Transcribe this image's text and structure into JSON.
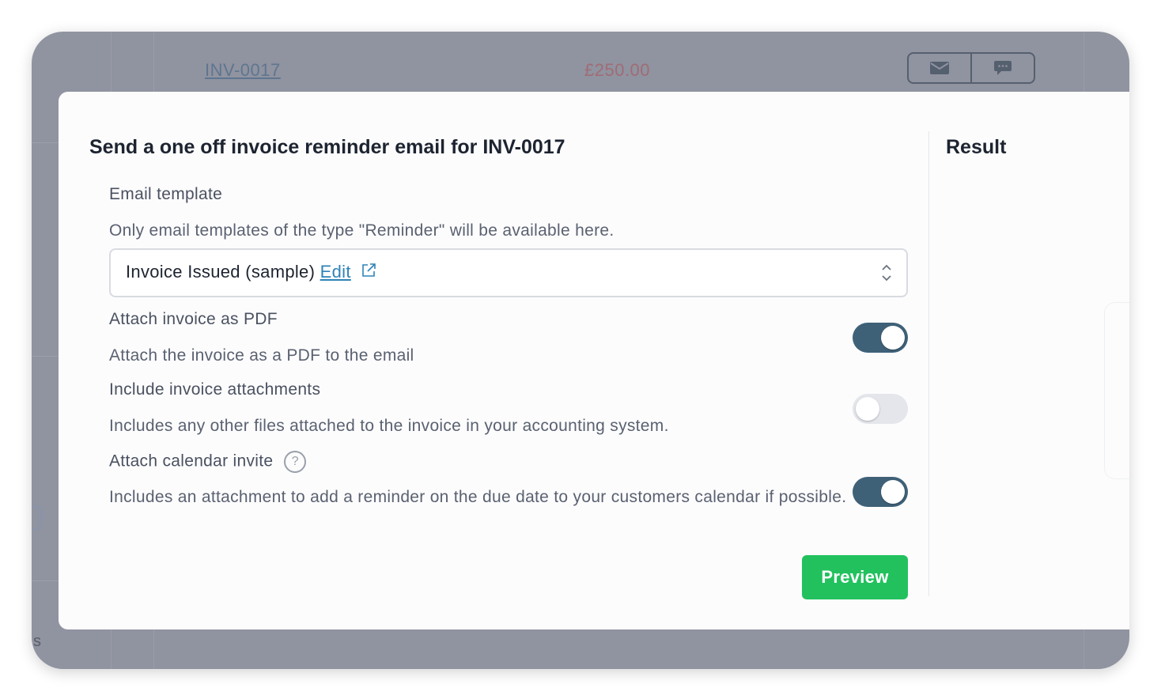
{
  "background": {
    "invoice_number": "INV-0017",
    "amount": "£250.00",
    "action_icons": [
      "envelope-icon",
      "chat-bubble-icon"
    ],
    "partial_text": "s"
  },
  "modal": {
    "title": "Send a one off invoice reminder email for INV-0017",
    "email_template": {
      "label": "Email template",
      "help": "Only email templates of the type \"Reminder\" will be available here.",
      "selected": "Invoice Issued (sample)",
      "edit_label": "Edit"
    },
    "attach_pdf": {
      "label": "Attach invoice as PDF",
      "help": "Attach the invoice as a PDF to the email",
      "enabled": true
    },
    "include_attachments": {
      "label": "Include invoice attachments",
      "help": "Includes any other files attached to the invoice in your accounting system.",
      "enabled": false
    },
    "calendar_invite": {
      "label": "Attach calendar invite",
      "help": "Includes an attachment to add a reminder on the due date to your customers calendar if possible.",
      "enabled": true
    },
    "preview_label": "Preview",
    "result_title": "Result"
  },
  "colors": {
    "toggle_on": "#3f6178",
    "toggle_off": "#e4e6eb",
    "primary_button": "#22c15e",
    "link": "#2f83b8",
    "overlay": "#9093a0"
  }
}
